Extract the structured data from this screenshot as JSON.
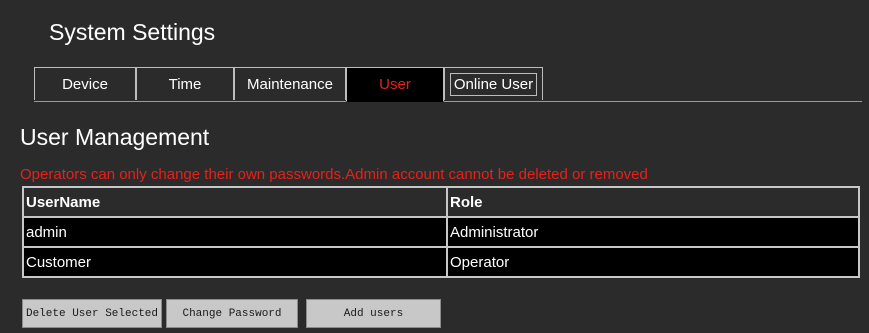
{
  "page": {
    "title": "System Settings"
  },
  "tabs": [
    {
      "label": "Device",
      "active": false
    },
    {
      "label": "Time",
      "active": false
    },
    {
      "label": "Maintenance",
      "active": false
    },
    {
      "label": "User",
      "active": true
    },
    {
      "label": "Online User",
      "active": false
    }
  ],
  "section": {
    "heading": "User Management",
    "note": "Operators can only change their own passwords.Admin account cannot be deleted or removed"
  },
  "table": {
    "headers": [
      "UserName",
      "Role"
    ],
    "rows": [
      [
        "admin",
        "Administrator"
      ],
      [
        "Customer",
        "Operator"
      ]
    ]
  },
  "actions": {
    "delete_label": "Delete User Selected",
    "change_label": "Change Password",
    "add_label": "Add users"
  },
  "colors": {
    "background": "#2b2b2b",
    "accent_red": "#e8201a",
    "table_bg": "#000000",
    "button_bg": "#c8c8c8"
  }
}
